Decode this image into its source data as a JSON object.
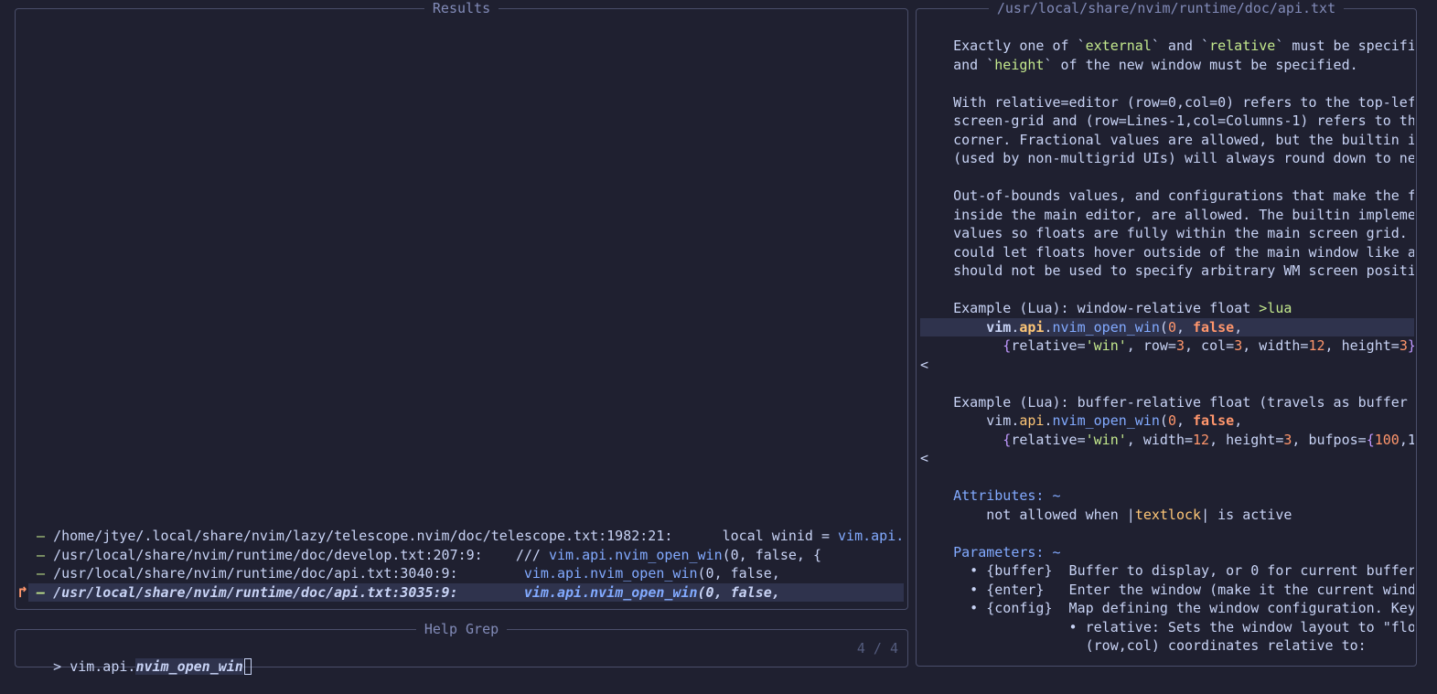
{
  "results_panel": {
    "title": "Results",
    "entries": [
      {
        "prefix": "–",
        "path": "/home/jtye/.local/share/nvim/lazy/telescope.nvim/doc/telescope.txt:1982:21:",
        "gap": "      ",
        "code_plain": "local winid = ",
        "code_hl": "vim.api.n",
        "code_rest": ""
      },
      {
        "prefix": "–",
        "path": "/usr/local/share/nvim/runtime/doc/develop.txt:207:9:",
        "gap": "    ",
        "code_plain": "/// ",
        "code_hl": "vim.api.nvim_open_win",
        "code_rest": "(0, false, {"
      },
      {
        "prefix": "–",
        "path": "/usr/local/share/nvim/runtime/doc/api.txt:3040:9:",
        "gap": "        ",
        "code_plain": "",
        "code_hl": "vim.api.nvim_open_win",
        "code_rest": "(0, false,"
      },
      {
        "prefix": "–",
        "path": "/usr/local/share/nvim/runtime/doc/api.txt:3035:9:",
        "gap": "        ",
        "code_plain": "",
        "code_hl": "vim.api.nvim_open_win",
        "code_rest": "(0, false,"
      }
    ],
    "selection_marker": "↱"
  },
  "prompt_panel": {
    "title": "Help Grep",
    "prompt_char": ">",
    "query_prefix": "vim.api.",
    "query_match": "nvim_open_win",
    "counter": "4 / 4"
  },
  "preview_panel": {
    "title": "/usr/local/share/nvim/runtime/doc/api.txt",
    "lines": [
      [
        {
          "t": "    Exactly one of `",
          "c": "fg"
        },
        {
          "t": "external",
          "c": "green"
        },
        {
          "t": "` and `",
          "c": "fg"
        },
        {
          "t": "relative",
          "c": "green"
        },
        {
          "t": "` must be specifi",
          "c": "fg"
        }
      ],
      [
        {
          "t": "    and `",
          "c": "fg"
        },
        {
          "t": "height",
          "c": "green"
        },
        {
          "t": "` of the new window must be specified.",
          "c": "fg"
        }
      ],
      [],
      [
        {
          "t": "    With relative=editor (row=0,col=0) refers to the top-lef",
          "c": "fg"
        }
      ],
      [
        {
          "t": "    screen-grid and (row=Lines-1,col=Columns-1) refers to th",
          "c": "fg"
        }
      ],
      [
        {
          "t": "    corner. Fractional values are allowed, but the builtin i",
          "c": "fg"
        }
      ],
      [
        {
          "t": "    (used by non-multigrid UIs) will always round down to ne",
          "c": "fg"
        }
      ],
      [],
      [
        {
          "t": "    Out-of-bounds values, and configurations that make the f",
          "c": "fg"
        }
      ],
      [
        {
          "t": "    inside the main editor, are allowed. The builtin impleme",
          "c": "fg"
        }
      ],
      [
        {
          "t": "    values so floats are fully within the main screen grid.",
          "c": "fg"
        }
      ],
      [
        {
          "t": "    could let floats hover outside of the main window like a",
          "c": "fg"
        }
      ],
      [
        {
          "t": "    should not be used to specify arbitrary WM screen positi",
          "c": "fg"
        }
      ],
      [],
      [
        {
          "t": "    Example (Lua): window-relative float ",
          "c": "fg"
        },
        {
          "t": ">lua",
          "c": "green"
        }
      ],
      [
        {
          "t": "        ",
          "c": "fg"
        },
        {
          "t": "vim",
          "c": "fg",
          "b": true
        },
        {
          "t": ".",
          "c": "fg"
        },
        {
          "t": "api",
          "c": "yellow",
          "b": true
        },
        {
          "t": ".",
          "c": "fg"
        },
        {
          "t": "nvim_open_win",
          "c": "blue"
        },
        {
          "t": "(",
          "c": "fg"
        },
        {
          "t": "0",
          "c": "orange"
        },
        {
          "t": ", ",
          "c": "fg"
        },
        {
          "t": "false",
          "c": "orange",
          "b": true
        },
        {
          "t": ",",
          "c": "fg"
        }
      ],
      [
        {
          "t": "          {",
          "c": "purple"
        },
        {
          "t": "relative",
          "c": "fg"
        },
        {
          "t": "=",
          "c": "fg"
        },
        {
          "t": "'win'",
          "c": "green"
        },
        {
          "t": ", row=",
          "c": "fg"
        },
        {
          "t": "3",
          "c": "orange"
        },
        {
          "t": ", col=",
          "c": "fg"
        },
        {
          "t": "3",
          "c": "orange"
        },
        {
          "t": ", width=",
          "c": "fg"
        },
        {
          "t": "12",
          "c": "orange"
        },
        {
          "t": ", height=",
          "c": "fg"
        },
        {
          "t": "3",
          "c": "orange"
        },
        {
          "t": "}",
          "c": "purple"
        }
      ],
      [
        {
          "t": "<",
          "c": "fg"
        }
      ],
      [],
      [
        {
          "t": "    Example (Lua): buffer-relative float (travels as buffer ",
          "c": "fg"
        }
      ],
      [
        {
          "t": "        vim",
          "c": "fg"
        },
        {
          "t": ".",
          "c": "fg"
        },
        {
          "t": "api",
          "c": "yellow"
        },
        {
          "t": ".",
          "c": "fg"
        },
        {
          "t": "nvim_open_win",
          "c": "blue"
        },
        {
          "t": "(",
          "c": "fg"
        },
        {
          "t": "0",
          "c": "orange"
        },
        {
          "t": ", ",
          "c": "fg"
        },
        {
          "t": "false",
          "c": "orange",
          "b": true
        },
        {
          "t": ",",
          "c": "fg"
        }
      ],
      [
        {
          "t": "          {",
          "c": "purple"
        },
        {
          "t": "relative",
          "c": "fg"
        },
        {
          "t": "=",
          "c": "fg"
        },
        {
          "t": "'win'",
          "c": "green"
        },
        {
          "t": ", width=",
          "c": "fg"
        },
        {
          "t": "12",
          "c": "orange"
        },
        {
          "t": ", height=",
          "c": "fg"
        },
        {
          "t": "3",
          "c": "orange"
        },
        {
          "t": ", bufpos=",
          "c": "fg"
        },
        {
          "t": "{",
          "c": "purple"
        },
        {
          "t": "100",
          "c": "orange"
        },
        {
          "t": ",1",
          "c": "fg"
        }
      ],
      [
        {
          "t": "<",
          "c": "fg"
        }
      ],
      [],
      [
        {
          "t": "    Attributes: ~",
          "c": "blue"
        }
      ],
      [
        {
          "t": "        not allowed when |",
          "c": "fg"
        },
        {
          "t": "textlock",
          "c": "yellow"
        },
        {
          "t": "| is active",
          "c": "fg"
        }
      ],
      [],
      [
        {
          "t": "    Parameters: ~",
          "c": "blue"
        }
      ],
      [
        {
          "t": "      • {buffer}  Buffer to display, or 0 for current buffer",
          "c": "fg"
        }
      ],
      [
        {
          "t": "      • {enter}   Enter the window (make it the current wind",
          "c": "fg"
        }
      ],
      [
        {
          "t": "      • {config}  Map defining the window configuration. Key",
          "c": "fg"
        }
      ],
      [
        {
          "t": "                  • relative: Sets the window layout to \"flo",
          "c": "fg"
        }
      ],
      [
        {
          "t": "                    (row,col) coordinates relative to:",
          "c": "fg"
        }
      ]
    ]
  }
}
